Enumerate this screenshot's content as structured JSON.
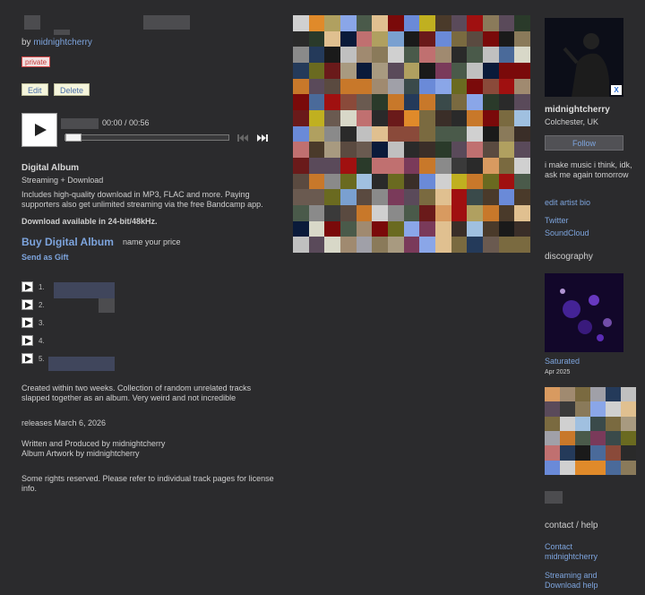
{
  "header": {
    "by_prefix": "by",
    "artist_link": "midnightcherry",
    "private_badge": "private"
  },
  "admin": {
    "edit": "Edit",
    "delete": "Delete"
  },
  "player": {
    "time": "00:00 / 00:56"
  },
  "purchase": {
    "format_title": "Digital Album",
    "format_sub": "Streaming + Download",
    "description": "Includes high-quality download in MP3, FLAC and more. Paying supporters also get unlimited streaming via the free Bandcamp app.",
    "quality": "Download available in 24-bit/48kHz.",
    "buy_label": "Buy Digital Album",
    "price_hint": "name your price",
    "gift": "Send as Gift"
  },
  "tracks": [
    "1.",
    "2.",
    "3.",
    "4.",
    "5."
  ],
  "about": "Created within two weeks. Collection of random unrelated tracks slapped together as an album. Very weird and not incredible",
  "release": "releases March 6, 2026",
  "credits_1": "Written and Produced by midnightcherry",
  "credits_2": "Album Artwork by midnightcherry",
  "rights": "Some rights reserved. Please refer to individual track pages for license info.",
  "sidebar": {
    "artist_name": "midnightcherry",
    "location": "Colchester, UK",
    "follow": "Follow",
    "bio": "i make music i think, idk, ask me again tomorrow",
    "edit_bio": "edit artist bio",
    "twitter": "Twitter",
    "soundcloud": "SoundCloud",
    "discography_title": "discography",
    "disc_title": "Saturated",
    "disc_date": "Apr 2025",
    "contact_title": "contact / help",
    "contact_link": "Contact midnightcherry",
    "help_link": "Streaming and Download help",
    "close_x": "X"
  },
  "colors": {
    "link": "#7da4dd",
    "background": "#2b2b2d",
    "text": "#cfcfcf"
  }
}
